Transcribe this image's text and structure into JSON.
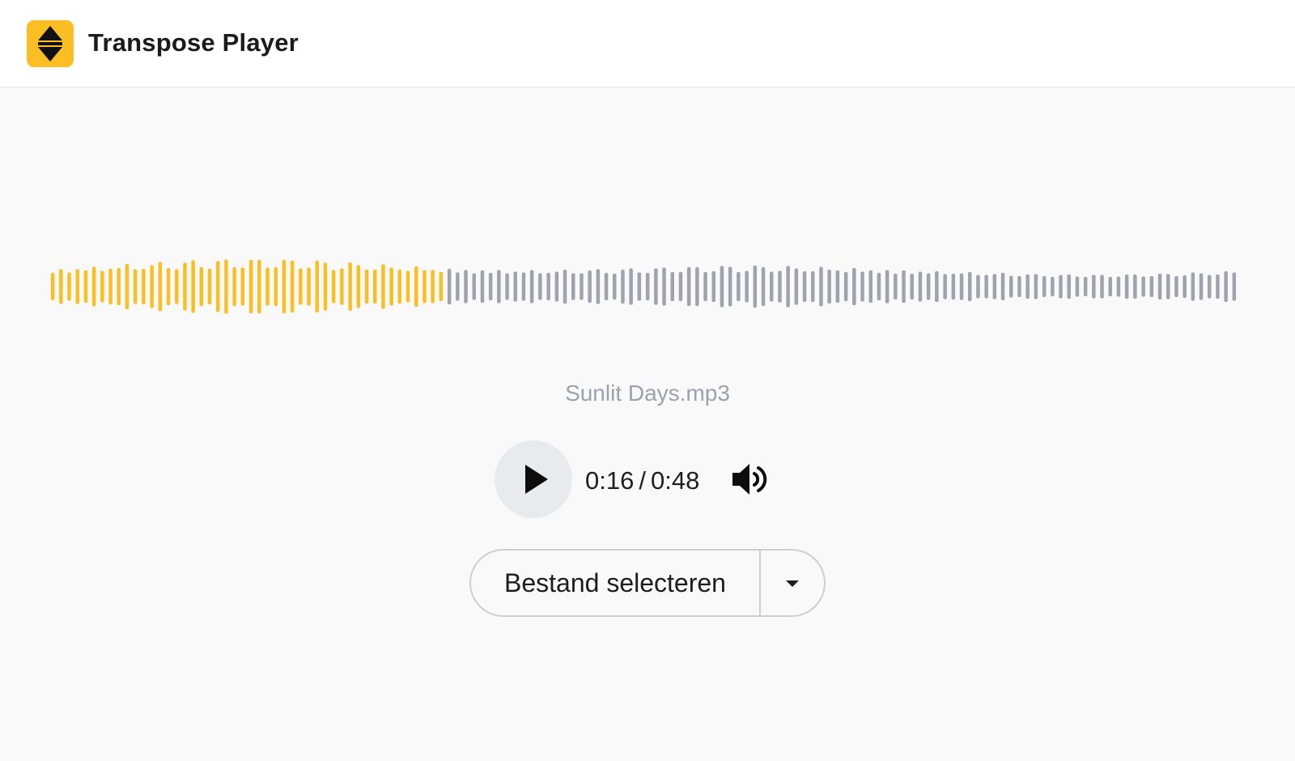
{
  "header": {
    "app_title": "Transpose Player",
    "logo_icon": "up-down-arrows-icon",
    "logo_color": "#fbbf24"
  },
  "player": {
    "filename": "Sunlit Days.mp3",
    "current_time": "0:16",
    "time_separator": "/",
    "duration": "0:48",
    "progress_fraction": 0.333,
    "played_color": "#fbbf24",
    "unplayed_color": "#9ea3ad",
    "play_icon": "play-icon",
    "volume_icon": "volume-high-icon"
  },
  "file_picker": {
    "button_label": "Bestand selecteren",
    "dropdown_icon": "caret-down-icon"
  }
}
